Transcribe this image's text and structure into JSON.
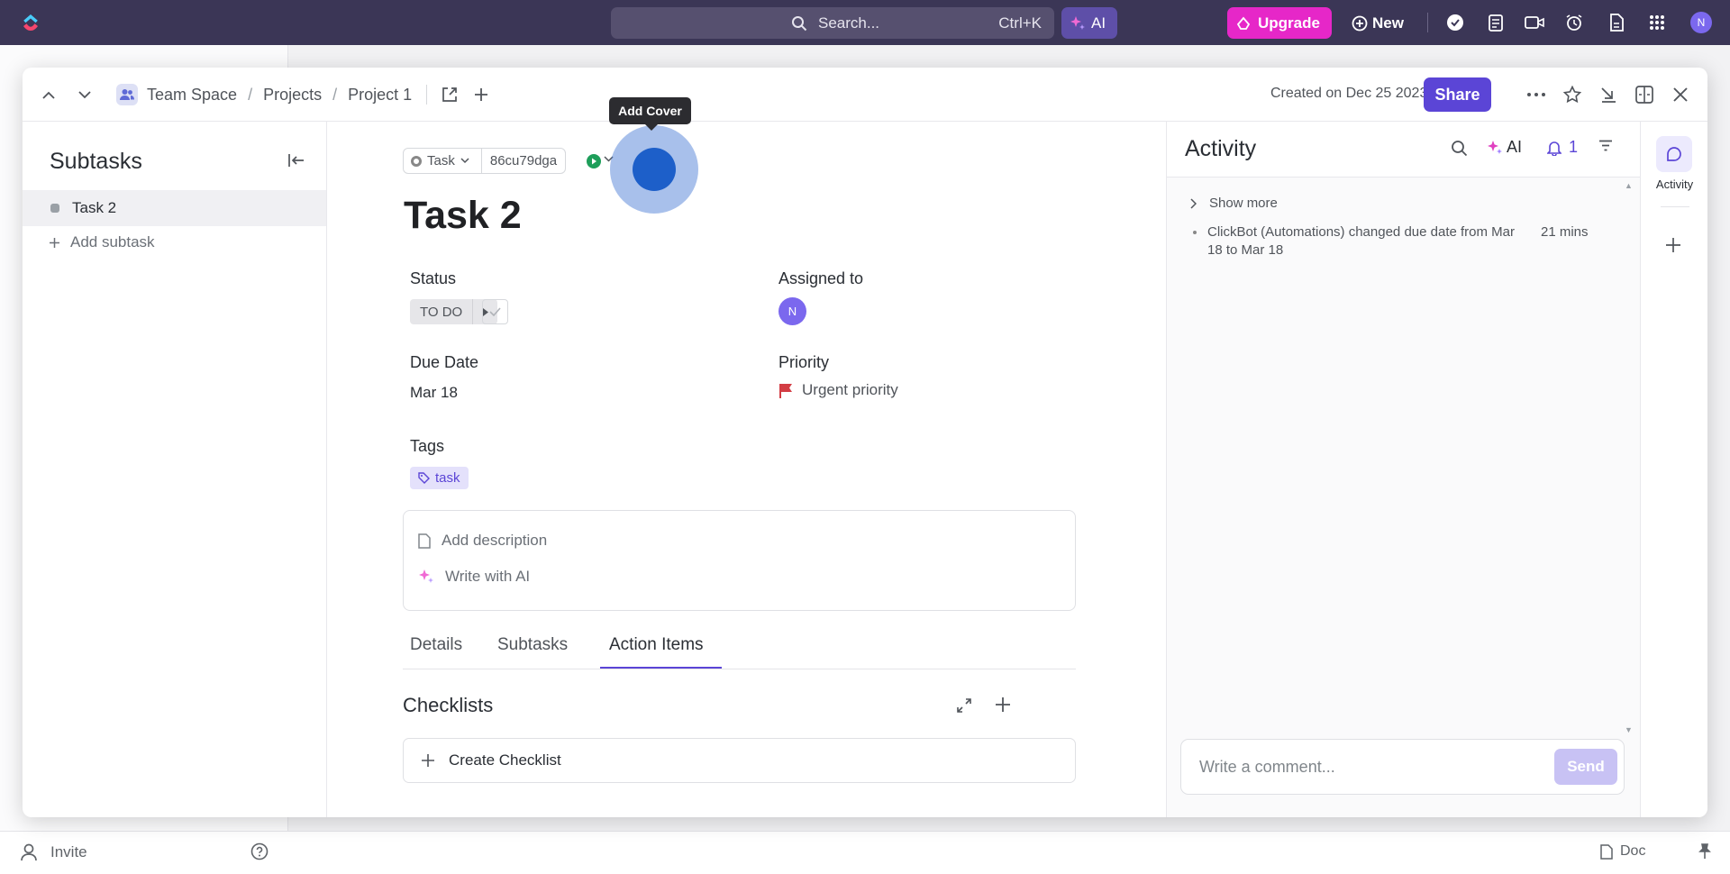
{
  "topbar": {
    "search_placeholder": "Search...",
    "search_shortcut": "Ctrl+K",
    "ai_label": "AI",
    "upgrade_label": "Upgrade",
    "new_label": "New",
    "avatar_initial": "N"
  },
  "footer": {
    "invite_label": "Invite",
    "doc_label": "Doc"
  },
  "modal": {
    "breadcrumb": [
      "Team Space",
      "Projects",
      "Project 1"
    ],
    "created_text": "Created on Dec 25 2023",
    "share_label": "Share"
  },
  "subtasks_panel": {
    "title": "Subtasks",
    "items": [
      {
        "label": "Task 2"
      }
    ],
    "add_label": "Add subtask"
  },
  "task": {
    "type_label": "Task",
    "id": "86cu79dga",
    "tooltip": "Add Cover",
    "title": "Task 2",
    "status_label": "Status",
    "status_value": "TO DO",
    "assigned_label": "Assigned to",
    "assignee_initial": "N",
    "due_label": "Due Date",
    "due_value": "Mar 18",
    "priority_label": "Priority",
    "priority_value": "Urgent priority",
    "tags_label": "Tags",
    "tags": [
      "task"
    ],
    "add_description": "Add description",
    "write_with_ai": "Write with AI",
    "tabs": [
      {
        "label": "Details",
        "active": false
      },
      {
        "label": "Subtasks",
        "active": false
      },
      {
        "label": "Action Items",
        "active": true
      }
    ],
    "checklists_title": "Checklists",
    "create_checklist": "Create Checklist"
  },
  "activity": {
    "title": "Activity",
    "ai_label": "AI",
    "notification_count": "1",
    "show_more": "Show more",
    "items": [
      {
        "text": "ClickBot (Automations) changed due date from Mar 18 to Mar 18",
        "time": "21 mins"
      }
    ],
    "comment_placeholder": "Write a comment...",
    "send_label": "Send"
  },
  "rail": {
    "activity_label": "Activity"
  },
  "colors": {
    "topbar": "#3b3656",
    "accent": "#5b45d6",
    "upgrade": "#e627c8",
    "priority_flag": "#d33d44"
  }
}
